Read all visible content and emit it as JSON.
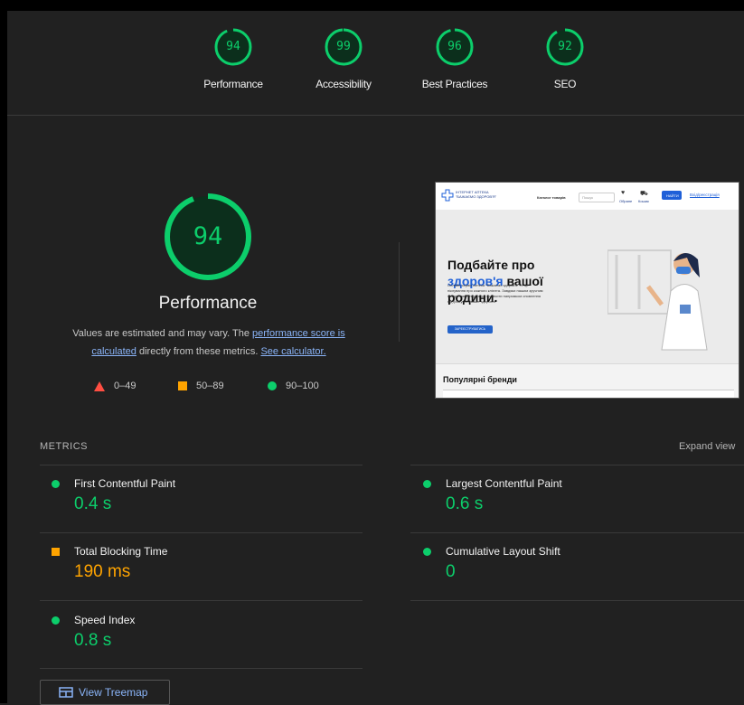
{
  "scores": [
    {
      "label": "Performance",
      "value": "94",
      "score": 0.94
    },
    {
      "label": "Accessibility",
      "value": "99",
      "score": 0.99
    },
    {
      "label": "Best Practices",
      "value": "96",
      "score": 0.96
    },
    {
      "label": "SEO",
      "value": "92",
      "score": 0.92
    }
  ],
  "performance": {
    "score": "94",
    "title": "Performance",
    "desc_prefix": "Values are estimated and may vary. The ",
    "desc_link1": "performance score is calculated",
    "desc_middle": " directly from these metrics. ",
    "desc_link2": "See calculator."
  },
  "legend": {
    "fail": "0–49",
    "average": "50–89",
    "pass": "90–100"
  },
  "thumbnail": {
    "brand_line1": "ІНТЕРНЕТ АПТЕКА",
    "brand_line2": "\"БАЖАЄМО ЗДОРОВ'Я\"",
    "nav_catalog": "Каталог товарів",
    "search": "Пошук",
    "fav": "Обране",
    "cart": "Кошик",
    "find_btn": "НАЙТИ",
    "login": "Вхід/реєстрація",
    "headline_1": "Подбайте про",
    "headline_2a": "здоров'я",
    "headline_2b": " вашої",
    "headline_3": "родини.",
    "body": "Онлайн-сервіс Аптека \"Бажаємо здоров'я\" — це піклування про кожного клієнта. Завдяки нашим зручним продуктам тепер легко побачити напрямком оновлення підтримувати ваше здоров'я.",
    "button": "ЗАРЕЄСТРУВАТИСЬ",
    "brands": "Популярні бренди"
  },
  "metrics_header": "METRICS",
  "expand": "Expand view",
  "metrics": {
    "fcp": {
      "label": "First Contentful Paint",
      "value": "0.4 s"
    },
    "lcp": {
      "label": "Largest Contentful Paint",
      "value": "0.6 s"
    },
    "tbt": {
      "label": "Total Blocking Time",
      "value": "190 ms"
    },
    "cls": {
      "label": "Cumulative Layout Shift",
      "value": "0"
    },
    "si": {
      "label": "Speed Index",
      "value": "0.8 s"
    }
  },
  "treemap": "View Treemap",
  "colors": {
    "pass": "#0cce6b",
    "average": "#ffa400",
    "fail": "#ff4e42",
    "link": "#8ab4f8"
  }
}
